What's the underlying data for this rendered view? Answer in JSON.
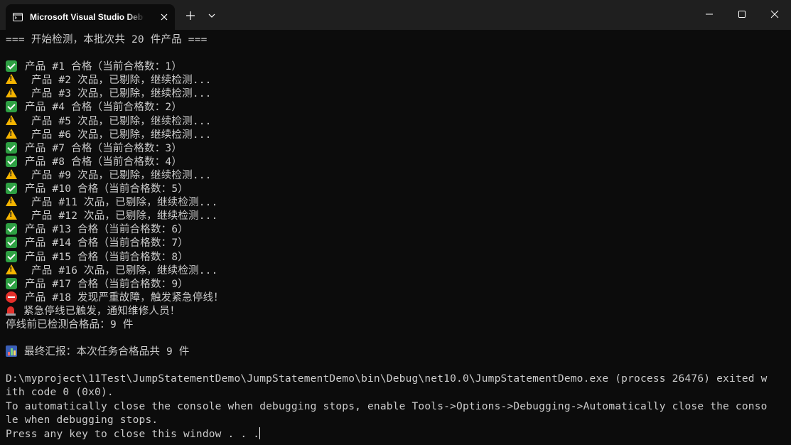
{
  "window": {
    "tab_title": "Microsoft Visual Studio Debug Console"
  },
  "console": {
    "lines": [
      {
        "icon": "",
        "text": "=== 开始检测，本批次共 20 件产品 ==="
      },
      {
        "icon": "",
        "text": ""
      },
      {
        "icon": "check-icon",
        "text": "产品 #1 合格（当前合格数：1）"
      },
      {
        "icon": "warning-icon",
        "text": "产品 #2 次品，已剔除，继续检测..."
      },
      {
        "icon": "warning-icon",
        "text": "产品 #3 次品，已剔除，继续检测..."
      },
      {
        "icon": "check-icon",
        "text": "产品 #4 合格（当前合格数：2）"
      },
      {
        "icon": "warning-icon",
        "text": "产品 #5 次品，已剔除，继续检测..."
      },
      {
        "icon": "warning-icon",
        "text": "产品 #6 次品，已剔除，继续检测..."
      },
      {
        "icon": "check-icon",
        "text": "产品 #7 合格（当前合格数：3）"
      },
      {
        "icon": "check-icon",
        "text": "产品 #8 合格（当前合格数：4）"
      },
      {
        "icon": "warning-icon",
        "text": "产品 #9 次品，已剔除，继续检测..."
      },
      {
        "icon": "check-icon",
        "text": "产品 #10 合格（当前合格数：5）"
      },
      {
        "icon": "warning-icon",
        "text": "产品 #11 次品，已剔除，继续检测..."
      },
      {
        "icon": "warning-icon",
        "text": "产品 #12 次品，已剔除，继续检测..."
      },
      {
        "icon": "check-icon",
        "text": "产品 #13 合格（当前合格数：6）"
      },
      {
        "icon": "check-icon",
        "text": "产品 #14 合格（当前合格数：7）"
      },
      {
        "icon": "check-icon",
        "text": "产品 #15 合格（当前合格数：8）"
      },
      {
        "icon": "warning-icon",
        "text": "产品 #16 次品，已剔除，继续检测..."
      },
      {
        "icon": "check-icon",
        "text": "产品 #17 合格（当前合格数：9）"
      },
      {
        "icon": "stop-icon",
        "text": "产品 #18 发现严重故障，触发紧急停线！"
      },
      {
        "icon": "siren-icon",
        "text": "紧急停线已触发，通知维修人员！"
      },
      {
        "icon": "",
        "text": "停线前已检测合格品：9 件"
      },
      {
        "icon": "",
        "text": ""
      },
      {
        "icon": "bar-chart-icon",
        "text": "最终汇报：本次任务合格品共 9 件"
      },
      {
        "icon": "",
        "text": ""
      },
      {
        "icon": "",
        "text": "D:\\myproject\\11Test\\JumpStatementDemo\\JumpStatementDemo\\bin\\Debug\\net10.0\\JumpStatementDemo.exe (process 26476) exited w"
      },
      {
        "icon": "",
        "text": "ith code 0 (0x0)."
      },
      {
        "icon": "",
        "text": "To automatically close the console when debugging stops, enable Tools->Options->Debugging->Automatically close the conso"
      },
      {
        "icon": "",
        "text": "le when debugging stops."
      },
      {
        "icon": "",
        "text": "Press any key to close this window . . ."
      }
    ]
  },
  "colors": {
    "background": "#0c0c0c",
    "titlebar": "#1f1f1f",
    "text": "#cccccc"
  }
}
